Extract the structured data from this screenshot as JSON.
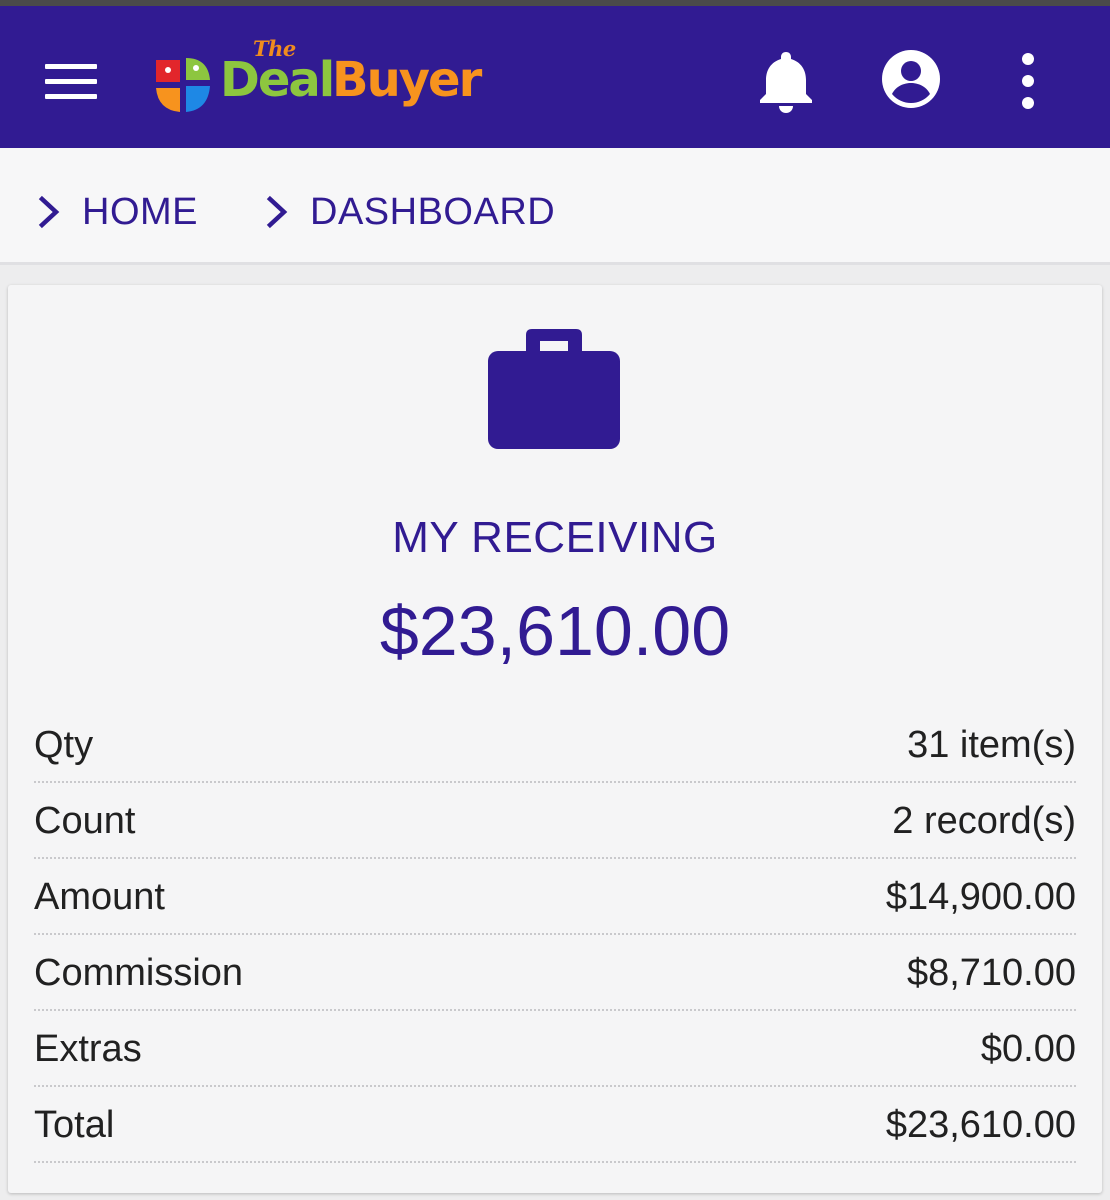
{
  "appbar": {
    "menu_icon": "hamburger-menu-icon",
    "logo": {
      "the": "The",
      "deal": "Deal",
      "buyer": "Buyer"
    },
    "notifications_icon": "bell-icon",
    "account_icon": "account-circle-icon",
    "more_icon": "more-vertical-icon",
    "colors": {
      "background": "#311b92",
      "logo_green": "#8dc63f",
      "logo_orange": "#f7931e"
    }
  },
  "breadcrumb": {
    "items": [
      {
        "label": "HOME",
        "icon": "chevron-right-icon"
      },
      {
        "label": "DASHBOARD",
        "icon": "chevron-right-icon"
      }
    ]
  },
  "card": {
    "icon": "briefcase-icon",
    "title": "MY RECEIVING",
    "total": "$23,610.00",
    "rows": [
      {
        "label": "Qty",
        "value": "31 item(s)"
      },
      {
        "label": "Count",
        "value": "2 record(s)"
      },
      {
        "label": "Amount",
        "value": "$14,900.00"
      },
      {
        "label": "Commission",
        "value": "$8,710.00"
      },
      {
        "label": "Extras",
        "value": "$0.00"
      },
      {
        "label": "Total",
        "value": "$23,610.00"
      }
    ]
  }
}
